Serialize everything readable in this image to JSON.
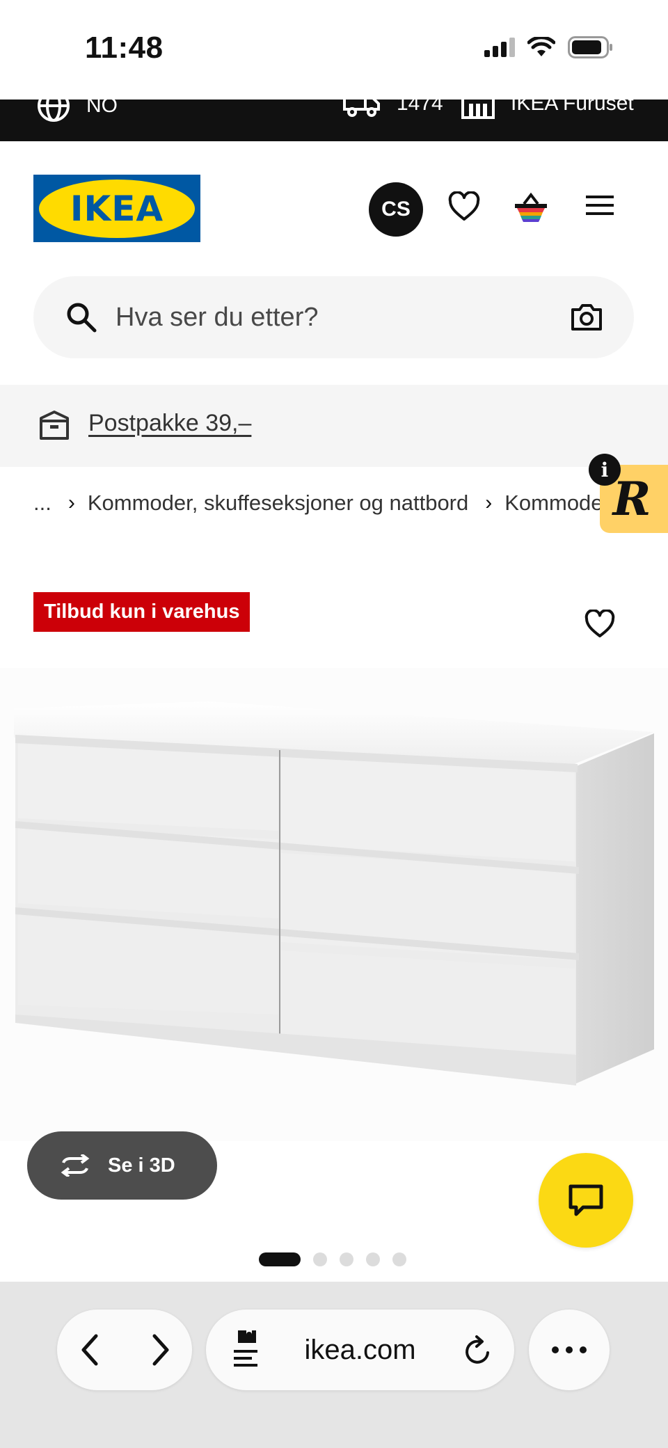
{
  "status_bar": {
    "time": "11:48"
  },
  "top_strip": {
    "language": "NO",
    "delivery_postcode": "1474",
    "store": "IKEA Furuset"
  },
  "header": {
    "logo_text": "IKEA",
    "avatar_initials": "CS",
    "brand_colors": {
      "blue": "#0058a3",
      "yellow": "#ffdb00"
    }
  },
  "search": {
    "placeholder": "Hva ser du etter?"
  },
  "promo": {
    "link_text": "Postpakke 39,–"
  },
  "breadcrumb": {
    "ellipsis": "...",
    "items": [
      "Kommoder, skuffeseksjoner og nattbord",
      "Kommoder"
    ]
  },
  "widget": {
    "letter": "R",
    "info": "i"
  },
  "product": {
    "offer_badge": "Tilbud kun i varehus",
    "offer_color": "#cc0008",
    "view3d_label": "Se i 3D",
    "carousel": {
      "count": 5,
      "active_index": 0
    }
  },
  "browser": {
    "url": "ikea.com"
  }
}
